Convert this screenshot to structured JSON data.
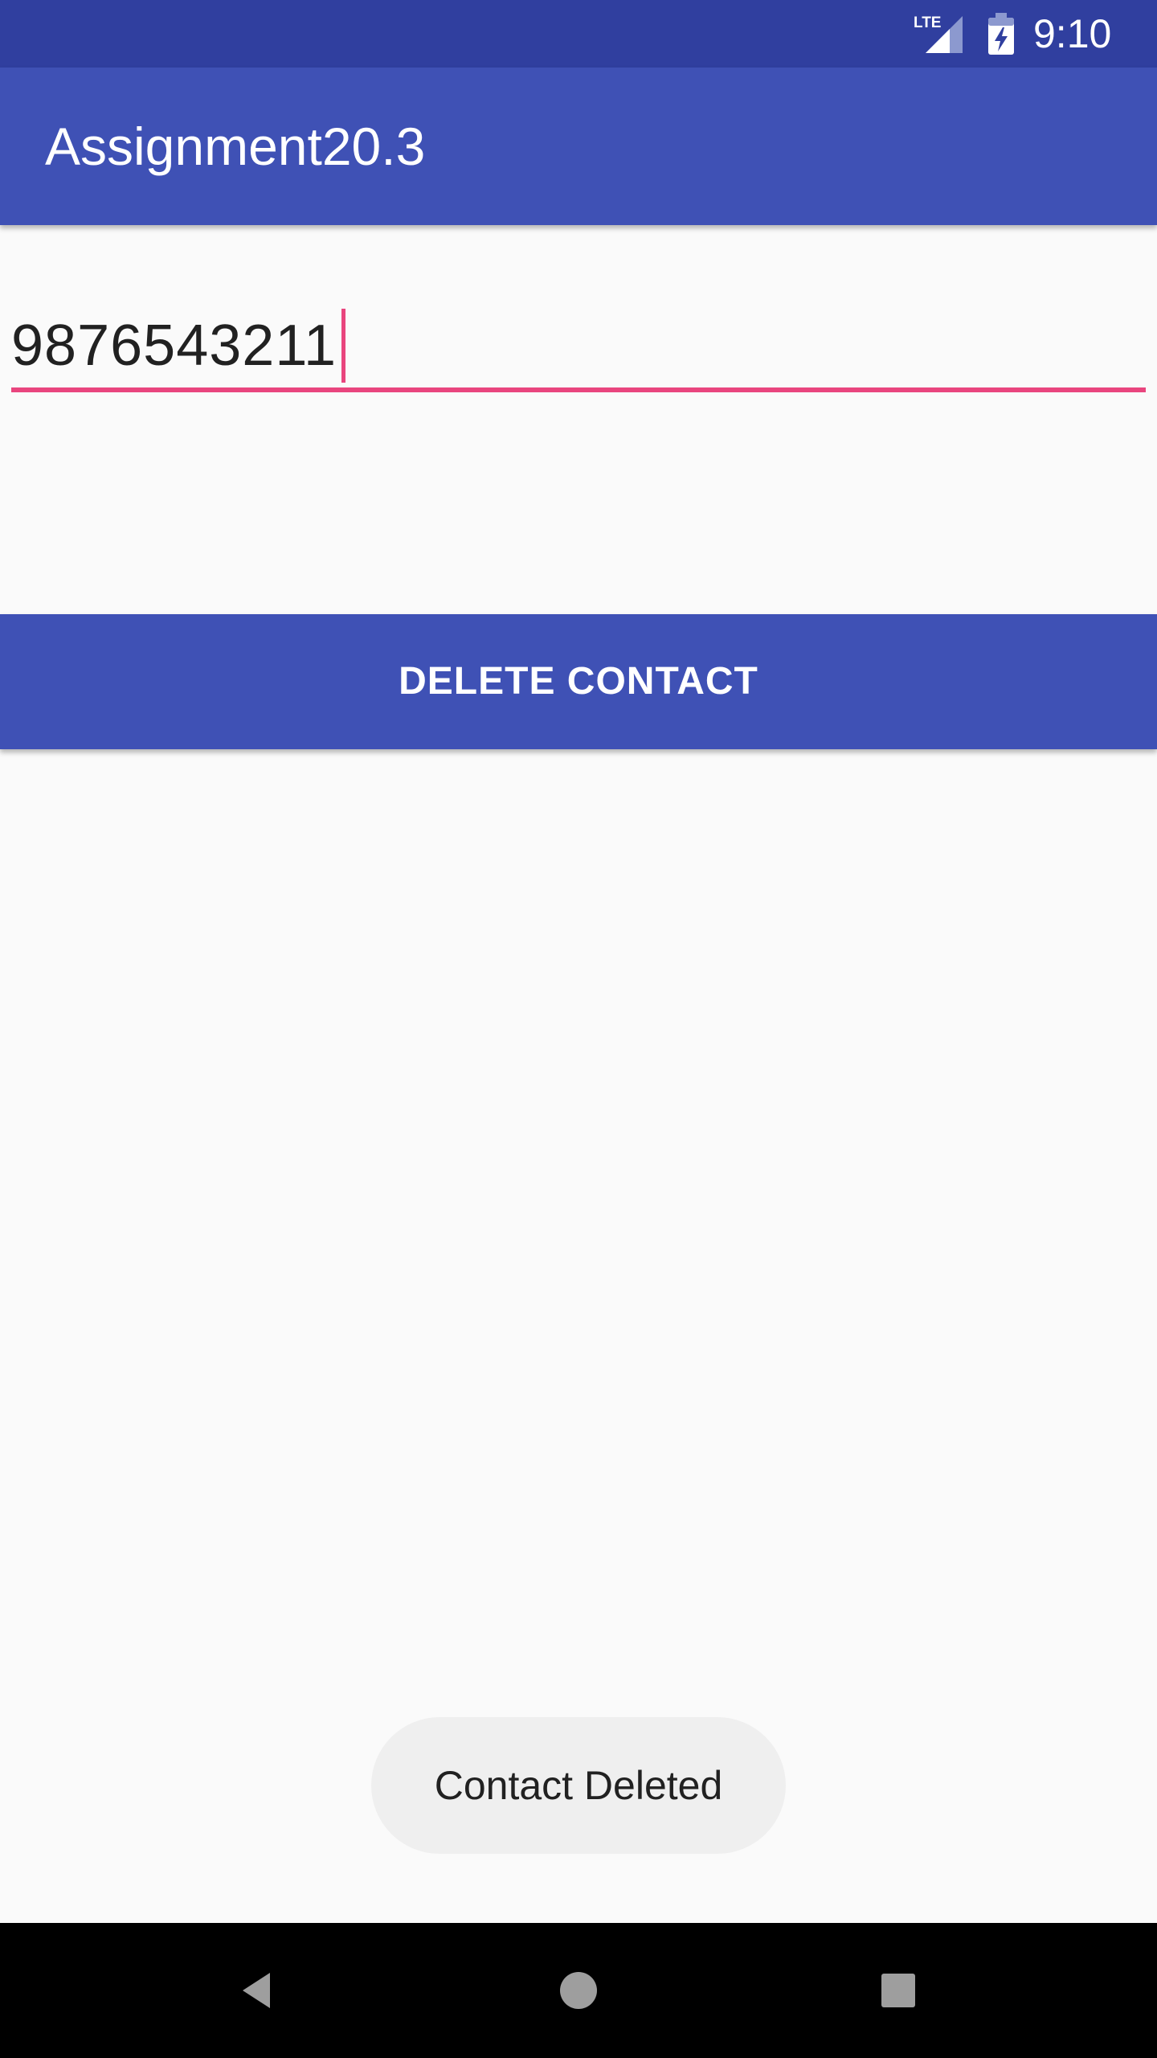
{
  "status_bar": {
    "network_label": "LTE",
    "network_icon": "lte-signal-icon",
    "battery_icon": "battery-charging-icon",
    "time": "9:10",
    "color": "#303f9f"
  },
  "app_bar": {
    "title": "Assignment20.3",
    "color": "#3f51b5"
  },
  "phone_input": {
    "value": "9876543211",
    "accent_color": "#e9457e"
  },
  "delete_button": {
    "label": "DELETE CONTACT"
  },
  "toast": {
    "message": "Contact Deleted"
  },
  "nav_bar": {
    "back_icon": "back-triangle-icon",
    "home_icon": "home-circle-icon",
    "recents_icon": "recents-square-icon"
  }
}
